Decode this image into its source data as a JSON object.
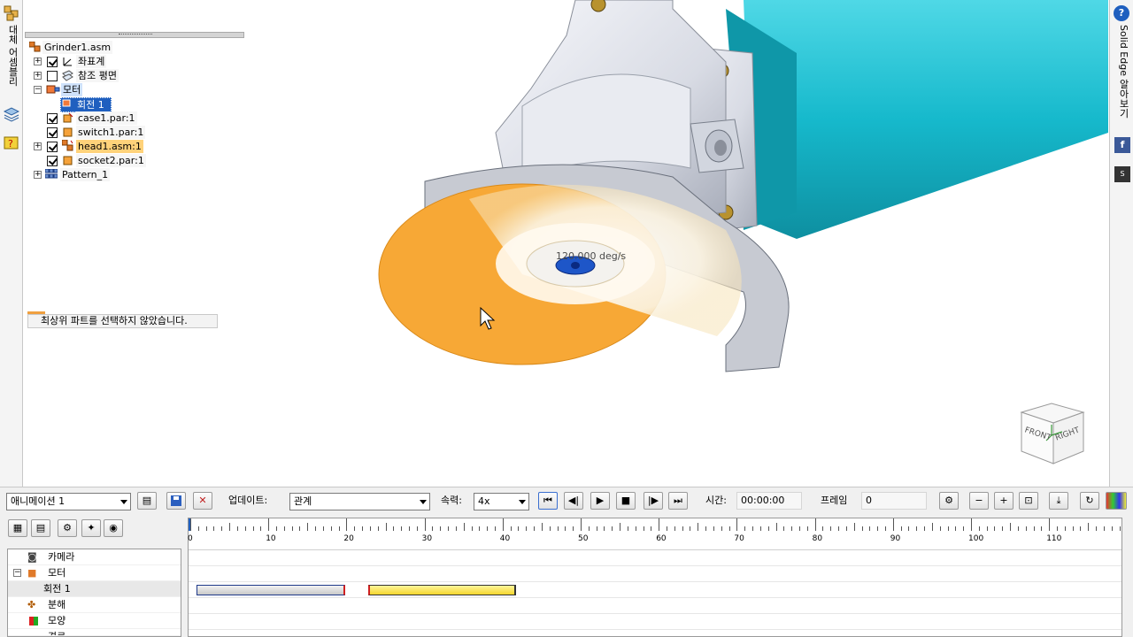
{
  "left_tabs": {
    "assembly_tab": "대체 어셈블리"
  },
  "tree": {
    "root": "Grinder1.asm",
    "items": [
      {
        "label": "좌표계"
      },
      {
        "label": "참조 평면"
      },
      {
        "label": "모터"
      },
      {
        "label": "회전 1"
      },
      {
        "label": "case1.par:1"
      },
      {
        "label": "switch1.par:1"
      },
      {
        "label": "head1.asm:1"
      },
      {
        "label": "socket2.par:1"
      },
      {
        "label": "Pattern_1"
      }
    ]
  },
  "message": "최상위 파트를 선택하지 않았습니다.",
  "viewport": {
    "speed_label": "120.000 deg/s",
    "cube_front": "FRONT",
    "cube_right": "RIGHT",
    "accent": "#1fb6c9",
    "disc_color": "#f7a836"
  },
  "right_tabs": {
    "help_tab": "Solid Edge 알아보기"
  },
  "anim": {
    "animation_select": "애니메이션 1",
    "update_label": "업데이트:",
    "update_select": "관계",
    "speed_label": "속력:",
    "speed_select": "4x",
    "time_label": "시간:",
    "time_value": "00:00:00",
    "frame_label": "프레임",
    "frame_value": "0",
    "list": [
      {
        "label": "카메라"
      },
      {
        "label": "모터"
      },
      {
        "label": "회전 1"
      },
      {
        "label": "분해"
      },
      {
        "label": "모양"
      },
      {
        "label": "경로"
      }
    ],
    "ticks": [
      "0",
      "10",
      "20",
      "30",
      "40",
      "50",
      "60",
      "70",
      "80",
      "90",
      "100",
      "110"
    ]
  }
}
